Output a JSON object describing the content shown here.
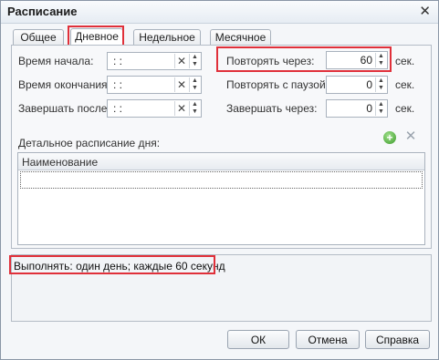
{
  "window": {
    "title": "Расписание",
    "close_glyph": "✕"
  },
  "tabs": [
    {
      "label": "Общее"
    },
    {
      "label": "Дневное",
      "active": true
    },
    {
      "label": "Недельное"
    },
    {
      "label": "Месячное"
    }
  ],
  "daily": {
    "start_time_label": "Время начала:",
    "start_time_value": " :  :",
    "end_time_label": "Время окончания:",
    "end_time_value": " :  :",
    "finish_after_label": "Завершать после:",
    "finish_after_value": " :  :",
    "repeat_every_label": "Повторять через:",
    "repeat_every_value": "60",
    "repeat_every_unit": "сек.",
    "repeat_pause_label": "Повторять с паузой:",
    "repeat_pause_value": "0",
    "repeat_pause_unit": "сек.",
    "finish_through_label": "Завершать через:",
    "finish_through_value": "0",
    "finish_through_unit": "сек."
  },
  "detail": {
    "section_label": "Детальное расписание дня:",
    "column_header": "Наименование",
    "add_icon": "plus-circle-icon",
    "delete_icon": "cross-icon"
  },
  "summary": {
    "text": "Выполнять: один день; каждые 60 секунд"
  },
  "buttons": {
    "ok": "ОК",
    "cancel": "Отмена",
    "help": "Справка"
  },
  "colors": {
    "highlight": "#e0303a",
    "add_icon": "#3c9b2b"
  }
}
